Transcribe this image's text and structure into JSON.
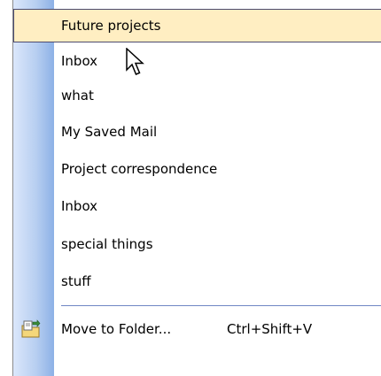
{
  "menu": {
    "items": [
      {
        "label": "Future projects",
        "highlighted": true
      },
      {
        "label": "Inbox"
      },
      {
        "label": "what"
      },
      {
        "label": "My Saved Mail"
      },
      {
        "label": "Project correspondence"
      },
      {
        "label": "Inbox"
      },
      {
        "label": "special things"
      },
      {
        "label": "stuff"
      }
    ],
    "move_to_folder": {
      "label": "Move to Folder...",
      "shortcut": "Ctrl+Shift+V",
      "icon": "move-to-folder-icon"
    }
  },
  "colors": {
    "highlight_bg": "#ffeec2",
    "highlight_border": "#4b4b6f",
    "gutter_dark": "#8db1e6",
    "gutter_light": "#dbe7fb"
  }
}
